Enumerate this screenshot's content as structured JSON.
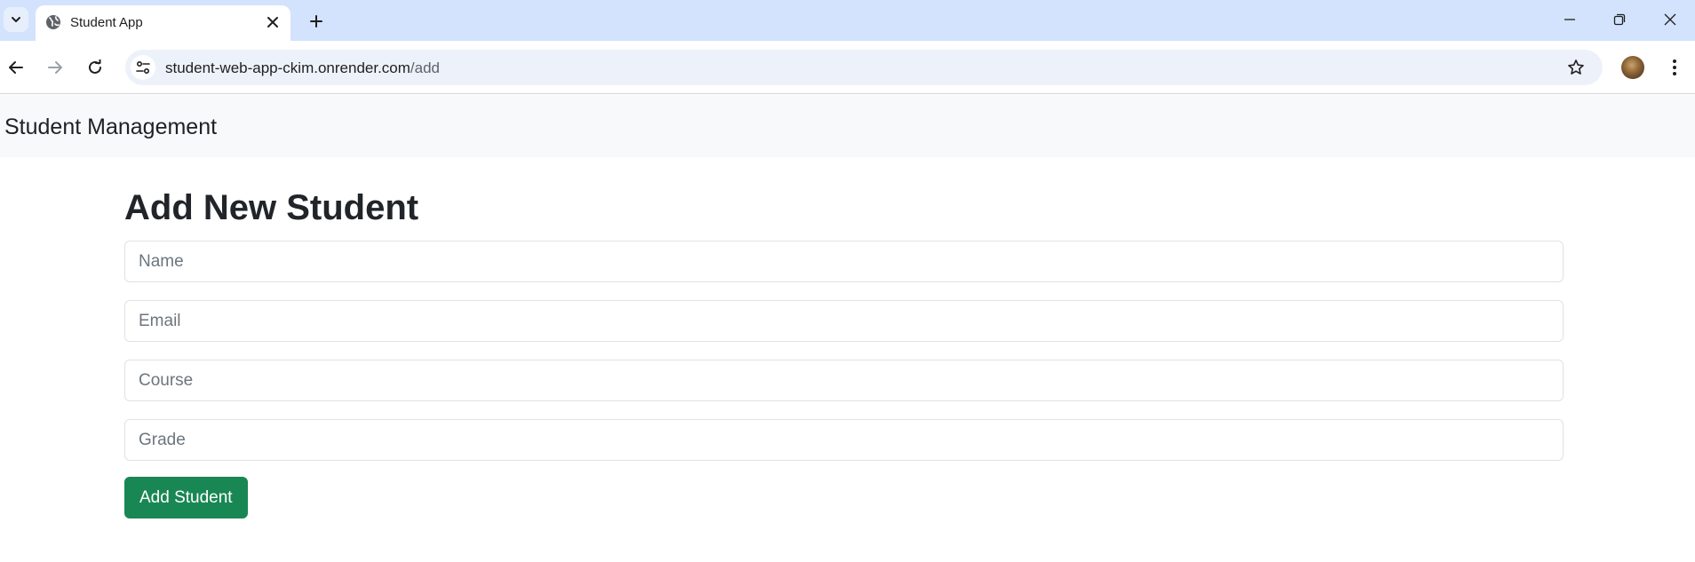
{
  "browser": {
    "tab": {
      "title": "Student App"
    },
    "address_bar": {
      "host": "student-web-app-ckim.onrender.com",
      "path": "/add"
    }
  },
  "page": {
    "navbar": {
      "brand": "Student Management"
    },
    "heading": "Add New Student",
    "form": {
      "fields": [
        {
          "name": "name",
          "value": "",
          "placeholder": "Name"
        },
        {
          "name": "email",
          "value": "",
          "placeholder": "Email"
        },
        {
          "name": "course",
          "value": "",
          "placeholder": "Course"
        },
        {
          "name": "grade",
          "value": "",
          "placeholder": "Grade"
        }
      ],
      "submit_label": "Add Student"
    }
  },
  "colors": {
    "tabstrip_bg": "#d3e3fd",
    "omnibox_bg": "#edf2fa",
    "navbar_bg": "#f8f9fa",
    "submit_bg": "#198754",
    "text": "#212529"
  },
  "icons": {
    "tab_search": "chevron-down-icon",
    "favicon": "globe-icon",
    "tab_close": "close-icon",
    "new_tab": "plus-icon",
    "minimize": "minimize-icon",
    "restore": "restore-icon",
    "close_window": "close-icon",
    "back": "back-arrow-icon",
    "forward": "forward-arrow-icon",
    "reload": "reload-icon",
    "site_info": "tune-icon",
    "bookmark": "star-icon",
    "profile": "avatar",
    "menu": "kebab-menu-icon"
  }
}
